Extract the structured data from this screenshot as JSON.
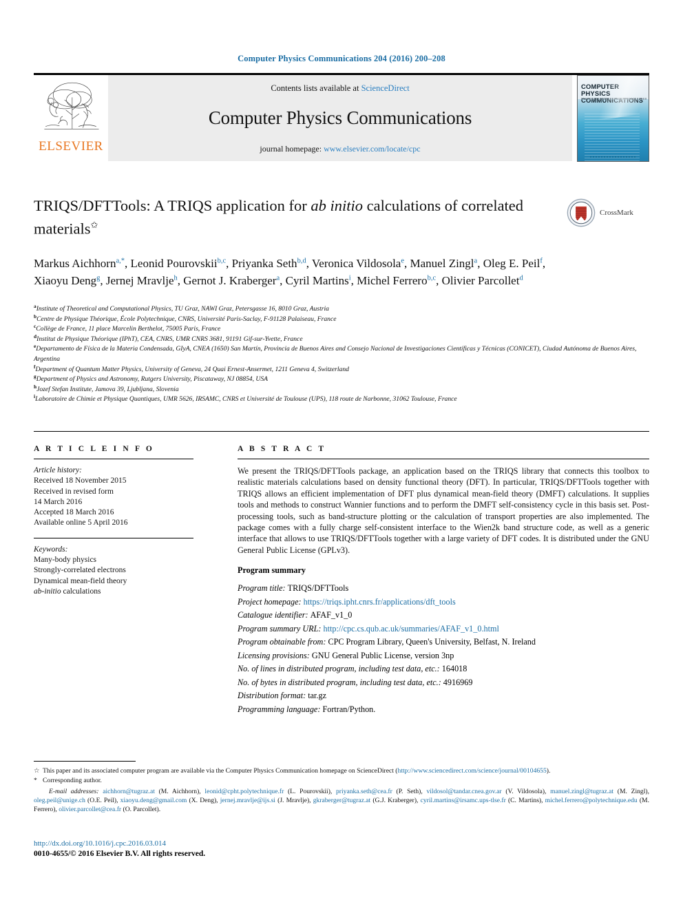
{
  "running_head": "Computer Physics Communications 204 (2016) 200–208",
  "masthead": {
    "contents_prefix": "Contents lists available at ",
    "sciencedirect": "ScienceDirect",
    "journal_name": "Computer Physics Communications",
    "homepage_prefix": "journal homepage: ",
    "homepage_url": "www.elsevier.com/locate/cpc",
    "publisher": "ELSEVIER",
    "cover": {
      "line1": "COMPUTER PHYSICS",
      "line2": "COMMUNICATIONS"
    }
  },
  "title": {
    "part1": "TRIQS/DFTTools: A TRIQS application for ",
    "italic": "ab initio",
    "part2": " calculations of correlated materials",
    "footnote_mark": "✩"
  },
  "crossmark": {
    "label": "CrossMark"
  },
  "authors": [
    {
      "name": "Markus Aichhorn",
      "sup": "a,*"
    },
    {
      "name": "Leonid Pourovskii",
      "sup": "b,c"
    },
    {
      "name": "Priyanka Seth",
      "sup": "b,d"
    },
    {
      "name": "Veronica Vildosola",
      "sup": "e"
    },
    {
      "name": "Manuel Zingl",
      "sup": "a"
    },
    {
      "name": "Oleg E. Peil",
      "sup": "f"
    },
    {
      "name": "Xiaoyu Deng",
      "sup": "g"
    },
    {
      "name": "Jernej Mravlje",
      "sup": "h"
    },
    {
      "name": "Gernot J. Kraberger",
      "sup": "a"
    },
    {
      "name": "Cyril Martins",
      "sup": "i"
    },
    {
      "name": "Michel Ferrero",
      "sup": "b,c"
    },
    {
      "name": "Olivier Parcollet",
      "sup": "d"
    }
  ],
  "affiliations": [
    {
      "mark": "a",
      "text": "Institute of Theoretical and Computational Physics, TU Graz, NAWI Graz, Petersgasse 16, 8010 Graz, Austria"
    },
    {
      "mark": "b",
      "text": "Centre de Physique Théorique, École Polytechnique, CNRS, Université Paris-Saclay, F-91128 Palaiseau, France"
    },
    {
      "mark": "c",
      "text": "Collège de France, 11 place Marcelin Berthelot, 75005 Paris, France"
    },
    {
      "mark": "d",
      "text": "Institut de Physique Théorique (IPhT), CEA, CNRS, UMR CNRS 3681, 91191 Gif-sur-Yvette, France"
    },
    {
      "mark": "e",
      "text": "Departamento de Física de la Materia Condensada, GIyA, CNEA (1650) San Martín, Provincia de Buenos Aires and Consejo Nacional de Investigaciones Científicas y Técnicas (CONICET), Ciudad Autónoma de Buenos Aires, Argentina"
    },
    {
      "mark": "f",
      "text": "Department of Quantum Matter Physics, University of Geneva, 24 Quai Ernest-Ansermet, 1211 Geneva 4, Switzerland"
    },
    {
      "mark": "g",
      "text": "Department of Physics and Astronomy, Rutgers University, Piscataway, NJ 08854, USA"
    },
    {
      "mark": "h",
      "text": "Jozef Stefan Institute, Jamova 39, Ljubljana, Slovenia"
    },
    {
      "mark": "i",
      "text": "Laboratoire de Chimie et Physique Quantiques, UMR 5626, IRSAMC, CNRS et Université de Toulouse (UPS), 118 route de Narbonne, 31062 Toulouse, France"
    }
  ],
  "article_info": {
    "heading": "A R T I C L E    I N F O",
    "history_label": "Article history:",
    "history": [
      "Received 18 November 2015",
      "Received in revised form",
      "14 March 2016",
      "Accepted 18 March 2016",
      "Available online 5 April 2016"
    ],
    "keywords_label": "Keywords:",
    "keywords": [
      "Many-body physics",
      "Strongly-correlated electrons",
      "Dynamical mean-field theory",
      "ab-initio calculations"
    ]
  },
  "abstract": {
    "heading": "A B S T R A C T",
    "text": "We present the TRIQS/DFTTools package, an application based on the TRIQS library that connects this toolbox to realistic materials calculations based on density functional theory (DFT). In particular, TRIQS/DFTTools together with TRIQS allows an efficient implementation of DFT plus dynamical mean-field theory (DMFT) calculations. It supplies tools and methods to construct Wannier functions and to perform the DMFT self-consistency cycle in this basis set. Post-processing tools, such as band-structure plotting or the calculation of transport properties are also implemented. The package comes with a fully charge self-consistent interface to the Wien2k band structure code, as well as a generic interface that allows to use TRIQS/DFTTools together with a large variety of DFT codes. It is distributed under the GNU General Public License (GPLv3)."
  },
  "program_summary": {
    "heading": "Program summary",
    "entries": [
      {
        "key": "Program title:",
        "value": "TRIQS/DFTTools",
        "link": false
      },
      {
        "key": "Project homepage:",
        "value": "https://triqs.ipht.cnrs.fr/applications/dft_tools",
        "link": true
      },
      {
        "key": "Catalogue identifier:",
        "value": "AFAF_v1_0",
        "link": false
      },
      {
        "key": "Program summary URL:",
        "value": "http://cpc.cs.qub.ac.uk/summaries/AFAF_v1_0.html",
        "link": true
      },
      {
        "key": "Program obtainable from:",
        "value": "CPC Program Library, Queen's University, Belfast, N. Ireland",
        "link": false
      },
      {
        "key": "Licensing provisions:",
        "value": "GNU General Public License, version 3np",
        "link": false
      },
      {
        "key": "No. of lines in distributed program, including test data, etc.:",
        "value": "164018",
        "link": false
      },
      {
        "key": "No. of bytes in distributed program, including test data, etc.:",
        "value": "4916969",
        "link": false
      },
      {
        "key": "Distribution format:",
        "value": "tar.gz",
        "link": false
      },
      {
        "key": "Programming language:",
        "value": "Fortran/Python.",
        "link": false
      }
    ]
  },
  "footnotes": {
    "star_note_prefix": "This paper and its associated computer program are available via the Computer Physics Communication homepage on ScienceDirect  (",
    "star_note_link": "http://www.sciencedirect.com/science/journal/00104655",
    "star_note_suffix": ").",
    "corresponding": "Corresponding author.",
    "emails_label": "E-mail addresses:",
    "emails": [
      {
        "addr": "aichhorn@tugraz.at",
        "who": "(M. Aichhorn)"
      },
      {
        "addr": "leonid@cpht.polytechnique.fr",
        "who": "(L. Pourovskii)"
      },
      {
        "addr": "priyanka.seth@cea.fr",
        "who": "(P. Seth)"
      },
      {
        "addr": "vildosol@tandar.cnea.gov.ar",
        "who": "(V. Vildosola)"
      },
      {
        "addr": "manuel.zingl@tugraz.at",
        "who": "(M. Zingl)"
      },
      {
        "addr": "oleg.peil@unige.ch",
        "who": "(O.E. Peil)"
      },
      {
        "addr": "xiaoyu.deng@gmail.com",
        "who": "(X. Deng)"
      },
      {
        "addr": "jernej.mravlje@ijs.si",
        "who": "(J. Mravlje)"
      },
      {
        "addr": "gkraberger@tugraz.at",
        "who": "(G.J. Kraberger)"
      },
      {
        "addr": "cyril.martins@irsamc.ups-tlse.fr",
        "who": "(C. Martins)"
      },
      {
        "addr": "michel.ferrero@polytechnique.edu",
        "who": "(M. Ferrero)"
      },
      {
        "addr": "olivier.parcollet@cea.fr",
        "who": "(O. Parcollet)"
      }
    ]
  },
  "doi": {
    "url": "http://dx.doi.org/10.1016/j.cpc.2016.03.014",
    "copyright": "0010-4655/© 2016 Elsevier B.V. All rights reserved."
  },
  "colors": {
    "link": "#1c6ea4",
    "elsevier_orange": "#E87722",
    "masthead_bg": "#ececec"
  }
}
